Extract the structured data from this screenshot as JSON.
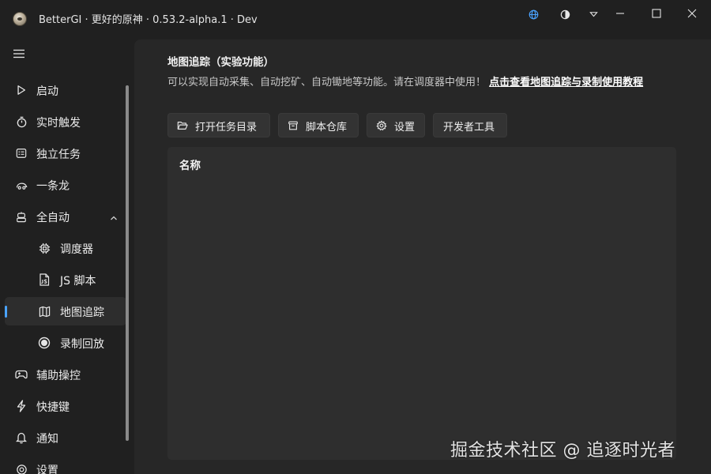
{
  "window": {
    "title": "BetterGI · 更好的原神 · 0.53.2-alpha.1 · Dev"
  },
  "titlebar_icons": [
    "globe-icon",
    "theme-contrast-icon",
    "dropdown-icon"
  ],
  "sidebar": {
    "items": [
      {
        "label": "启动",
        "icon": "play-icon"
      },
      {
        "label": "实时触发",
        "icon": "stopwatch-icon"
      },
      {
        "label": "独立任务",
        "icon": "list-icon"
      },
      {
        "label": "一条龙",
        "icon": "dragon-icon"
      },
      {
        "label": "全自动",
        "icon": "robot-icon",
        "expanded": true
      },
      {
        "label": "调度器",
        "icon": "chip-icon"
      },
      {
        "label": "JS 脚本",
        "icon": "js-file-icon"
      },
      {
        "label": "地图追踪",
        "icon": "map-icon",
        "selected": true
      },
      {
        "label": "录制回放",
        "icon": "record-icon"
      },
      {
        "label": "辅助操控",
        "icon": "gamepad-icon"
      },
      {
        "label": "快捷键",
        "icon": "flash-icon"
      },
      {
        "label": "通知",
        "icon": "bell-icon"
      },
      {
        "label": "设置",
        "icon": "gear-icon"
      }
    ]
  },
  "page": {
    "title": "地图追踪（实验功能）",
    "description": "可以实现自动采集、自动挖矿、自动锄地等功能。请在调度器中使用！",
    "link": "点击查看地图追踪与录制使用教程"
  },
  "toolbar": {
    "open_dir": "打开任务目录",
    "repo": "脚本仓库",
    "settings": "设置",
    "dev_tools": "开发者工具"
  },
  "table": {
    "columns": [
      "名称"
    ]
  },
  "watermark": "掘金技术社区 @ 追逐时光者",
  "colors": {
    "accent": "#4aa3ff",
    "background": "#202020",
    "content": "#272727",
    "panel": "#2e2e2e"
  }
}
